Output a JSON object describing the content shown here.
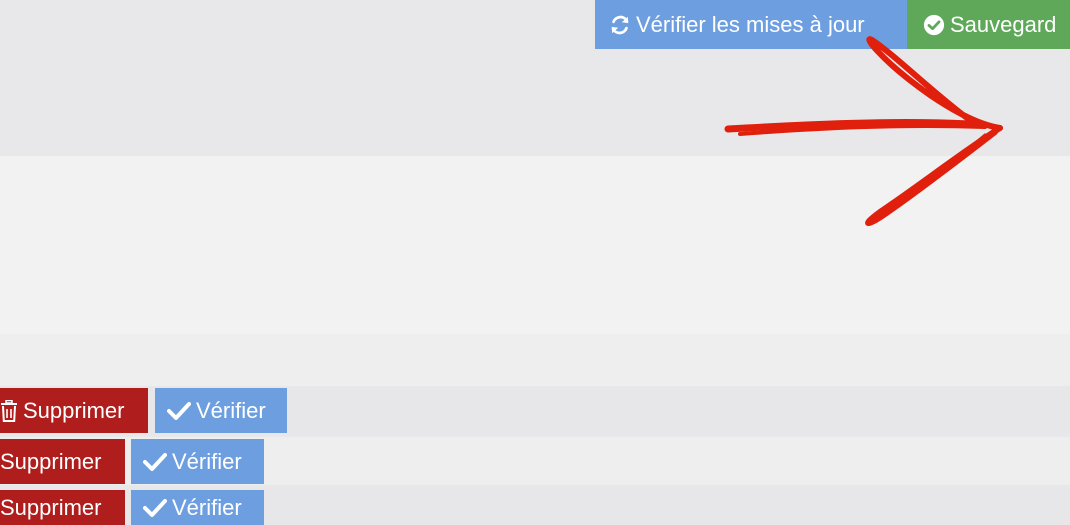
{
  "toolbar": {
    "check_updates_label": "Vérifier les mises à jour",
    "check_updates_icon": "refresh-icon",
    "save_label": "Sauvegard",
    "save_icon": "check-circle-icon"
  },
  "rows": [
    {
      "delete_label": "Supprimer",
      "delete_icon": "trash-icon",
      "verify_label": "Vérifier",
      "verify_icon": "checkmark-icon"
    },
    {
      "delete_label": "Supprimer",
      "verify_label": "Vérifier",
      "verify_icon": "checkmark-icon"
    },
    {
      "delete_label": "Supprimer",
      "verify_label": "Vérifier",
      "verify_icon": "checkmark-icon"
    }
  ],
  "colors": {
    "blue_button": "#6d9fe0",
    "green_button": "#5fa85a",
    "red_button": "#b01d1d",
    "annotation_arrow": "#e0200d"
  }
}
